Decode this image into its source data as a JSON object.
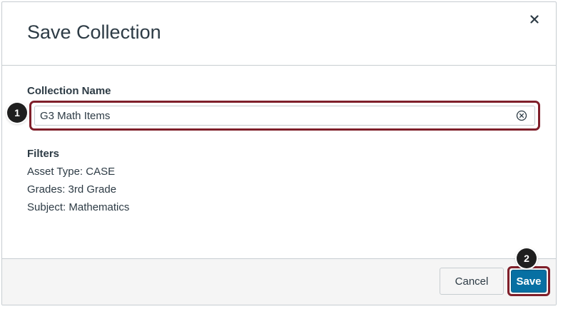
{
  "dialog": {
    "title": "Save Collection",
    "close_icon": "close-icon"
  },
  "form": {
    "collection_name_label": "Collection Name",
    "collection_name_value": "G3 Math Items",
    "clear_icon": "clear-circle-x-icon"
  },
  "filters": {
    "heading": "Filters",
    "lines": [
      "Asset Type: CASE",
      "Grades: 3rd Grade",
      "Subject: Mathematics"
    ]
  },
  "footer": {
    "cancel_label": "Cancel",
    "save_label": "Save"
  },
  "callouts": [
    "1",
    "2"
  ],
  "colors": {
    "primary": "#0770a3",
    "highlight": "#7f1f2a",
    "text": "#2d3b45",
    "footer_bg": "#f5f5f5"
  }
}
